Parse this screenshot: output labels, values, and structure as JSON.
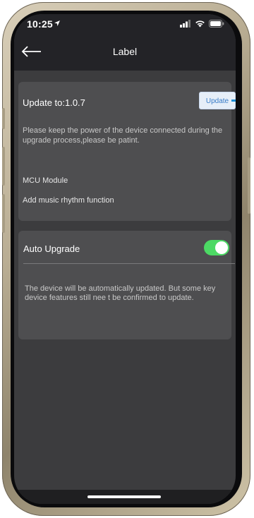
{
  "status_bar": {
    "time": "10:25"
  },
  "header": {
    "title": "Label",
    "back_icon": "arrow-left-icon"
  },
  "update_card": {
    "title": "Update to:1.0.7",
    "button_label": "Update",
    "notice": "Please keep the power of the device connected during the upgrade process,please be patint.",
    "module_name": "MCU Module",
    "module_description": "Add music rhythm function"
  },
  "auto_upgrade": {
    "label": "Auto Upgrade",
    "enabled": true,
    "description": "The device will be automatically updated. But some key device features still nee t be confirmed to update."
  },
  "colors": {
    "toggle_on": "#4cd964",
    "update_button_text": "#3a7dc8",
    "card_bg": "#4e4e50",
    "screen_bg": "#3c3c3e",
    "header_bg": "#232327"
  }
}
